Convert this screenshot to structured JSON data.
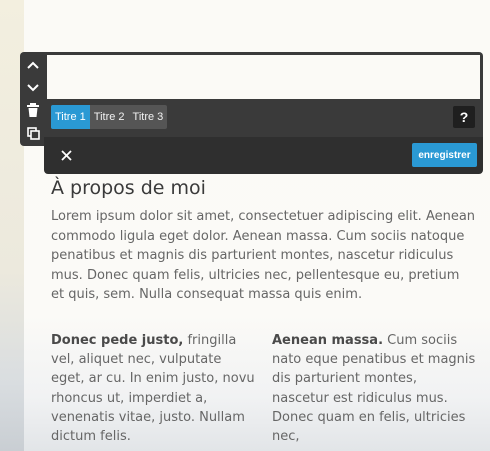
{
  "editor": {
    "field_value": "",
    "heading_tabs": [
      {
        "label": "Titre 1"
      },
      {
        "label": "Titre 2"
      },
      {
        "label": "Titre 3"
      }
    ],
    "help_label": "?",
    "save_label": "enregistrer"
  },
  "content": {
    "title": "À propos de moi",
    "intro": "Lorem ipsum dolor sit amet, consectetuer adipiscing elit. Aenean commodo ligula eget dolor. Aenean massa. Cum sociis natoque penatibus et magnis dis parturient montes, nascetur ridiculus mus. Donec quam felis, ultricies nec, pellentesque eu, pretium et quis, sem.  Nulla consequat massa quis enim.",
    "col1_bold": "Donec pede justo,",
    "col1_text": " fringilla vel, aliquet nec, vulputate eget, ar cu. In enim justo, novu rhoncus ut, imperdiet a, venenatis vitae, justo. Nullam dictum felis.",
    "col2_bold": "Aenean massa.",
    "col2_text": " Cum sociis nato eque penatibus et magnis dis parturient montes, nascetur est ridiculus mus. Donec quam en felis, ultricies nec,"
  }
}
